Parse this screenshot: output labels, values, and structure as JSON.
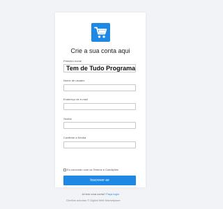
{
  "colors": {
    "accent": "#1e88e5",
    "background": "#f1f3f6",
    "card": "#ffffff"
  },
  "logo": {
    "icon": "shopping-cart-icon"
  },
  "form": {
    "title": "Crie a sua conta aqui",
    "fields": [
      {
        "label": "Primeiro nome",
        "value": "Tem de Tudo Programas"
      },
      {
        "label": "Nome de usuário",
        "value": ""
      },
      {
        "label": "Endereço de e-mail",
        "value": ""
      },
      {
        "label": "Senha",
        "value": ""
      },
      {
        "label": "Confirme a Senha",
        "value": ""
      }
    ],
    "terms_label": "Eu concordo com os Termos e Condições",
    "submit_label": "Inscrever-se",
    "login_prompt": "Já tem uma conta?",
    "login_link": "Faça login"
  },
  "footer": {
    "text": "Direitos autorais © Digital Web Marketplace"
  }
}
